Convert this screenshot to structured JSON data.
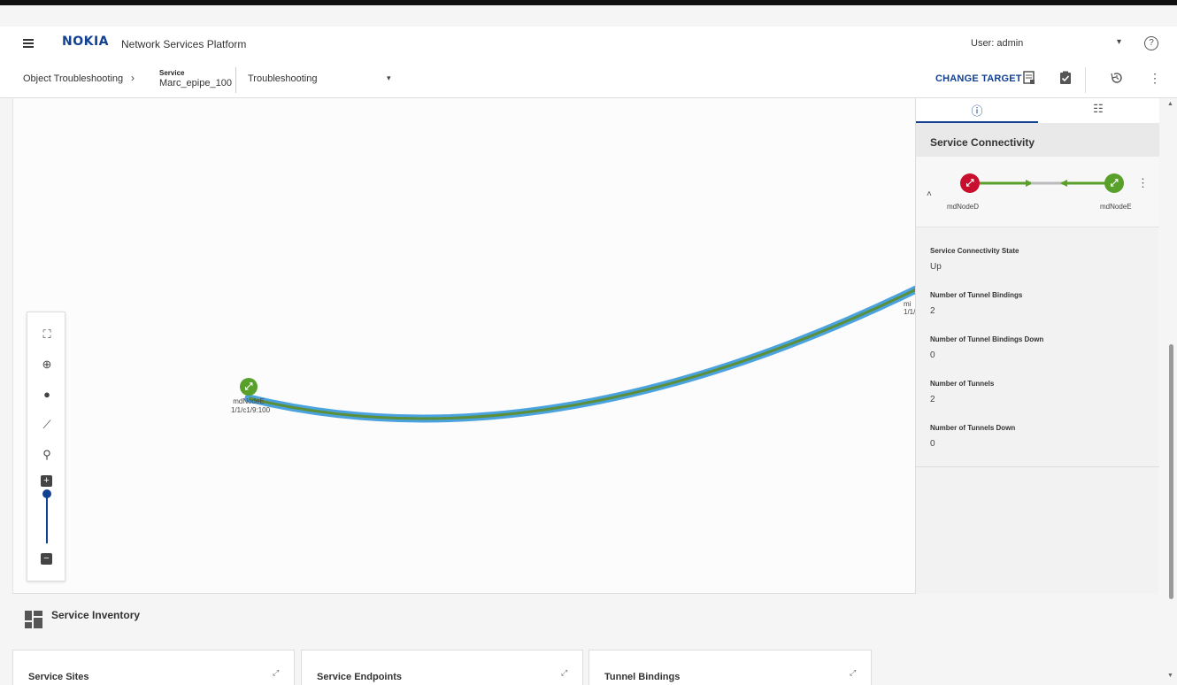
{
  "app": {
    "brand": "NOKIA",
    "title": "Network Services Platform",
    "user": "User: admin",
    "help": "?"
  },
  "toolbar": {
    "breadcrumb_root": "Object Troubleshooting",
    "service_label": "Service",
    "service_name": "Marc_epipe_100",
    "context": "Troubleshooting",
    "change_target": "CHANGE TARGET"
  },
  "map": {
    "nodes": [
      {
        "name": "mdNodeE",
        "port": "1/1/c1/9:100",
        "status": "up"
      },
      {
        "name": "mi",
        "port": "1/1/",
        "status": "up"
      }
    ],
    "zoom_level": 1.0
  },
  "panel": {
    "title": "Service Connectivity",
    "endpoint_a": "mdNodeD",
    "endpoint_b": "mdNodeE",
    "properties": [
      {
        "label": "Service Connectivity State",
        "value": "Up"
      },
      {
        "label": "Number of Tunnel Bindings",
        "value": "2"
      },
      {
        "label": "Number of Tunnel Bindings Down",
        "value": "0"
      },
      {
        "label": "Number of Tunnels",
        "value": "2"
      },
      {
        "label": "Number of Tunnels Down",
        "value": "0"
      }
    ]
  },
  "inventory": {
    "title": "Service Inventory",
    "cards": [
      "Service Sites",
      "Service Endpoints",
      "Tunnel Bindings"
    ]
  },
  "colors": {
    "accent": "#124191",
    "up": "#58a02a",
    "down": "#c8102e",
    "link": "#4aa3df"
  }
}
